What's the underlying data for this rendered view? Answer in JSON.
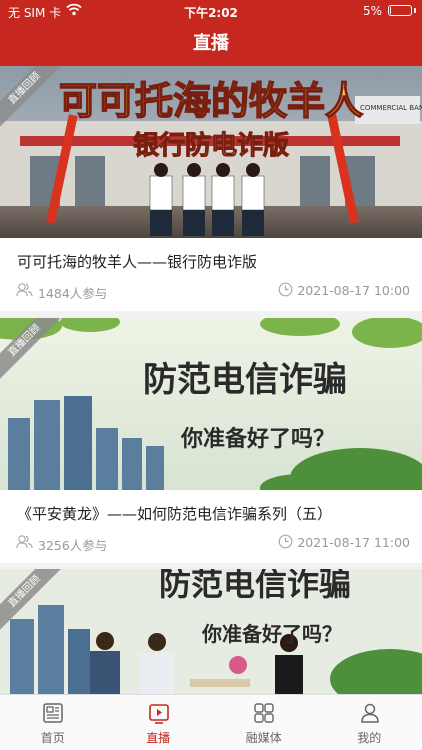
{
  "status_bar": {
    "carrier": "无 SIM 卡",
    "time": "下午2:02",
    "battery_percent": "5%",
    "battery_level": 0.05
  },
  "header": {
    "title": "直播"
  },
  "feed": {
    "items": [
      {
        "badge": "直播回顾",
        "banner_text": "可可托海的牧羊人",
        "banner_subtext": "银行防电诈版",
        "title": "可可托海的牧羊人——银行防电诈版",
        "participants": "1484人参与",
        "date": "2021-08-17 10:00"
      },
      {
        "badge": "直播回顾",
        "banner_text": "防范电信诈骗",
        "banner_subtext": "你准备好了吗？",
        "title": "《平安黄龙》——如何防范电信诈骗系列（五）",
        "participants": "3256人参与",
        "date": "2021-08-17 11:00"
      },
      {
        "badge": "直播回顾",
        "banner_text": "防范电信诈骗",
        "banner_subtext": "你准备好了吗？"
      }
    ]
  },
  "tab_bar": {
    "tabs": [
      {
        "label": "首页",
        "icon": "newspaper-icon"
      },
      {
        "label": "直播",
        "icon": "live-video-icon",
        "active": true
      },
      {
        "label": "融媒体",
        "icon": "grid-icon"
      },
      {
        "label": "我的",
        "icon": "person-icon"
      }
    ]
  },
  "colors": {
    "brand": "#c6281f",
    "inactive_tab": "#666666",
    "meta_text": "#999999"
  }
}
